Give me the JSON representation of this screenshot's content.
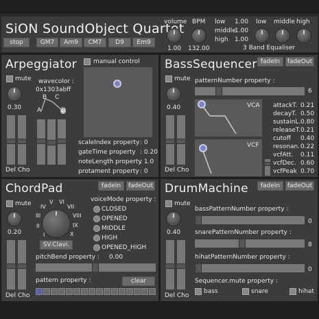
{
  "app": {
    "title": "SiON SoundObject Quartet"
  },
  "header": {
    "stop_label": "stop",
    "chords": [
      "GM7",
      "Am9",
      "CM7",
      "D9",
      "Em9"
    ],
    "volume": {
      "label": "volume",
      "value": "1.00"
    },
    "bpm": {
      "label": "BPM",
      "value": "132.00"
    },
    "eq_levels": [
      {
        "name": "low",
        "value": "1.00"
      },
      {
        "name": "middle",
        "value": "1.00"
      },
      {
        "name": "high",
        "value": "1.00"
      }
    ],
    "eq_knobs": [
      "low",
      "middle",
      "high"
    ],
    "eq_title": "3 Band Equaliser"
  },
  "arpeggiator": {
    "title": "Arpeggiator",
    "mute_label": "mute",
    "level": "0.30",
    "wavecolor_label": "wavecolor :",
    "wavecolor_value": "0x1303abff",
    "adsr_labels": {
      "a": "A",
      "b": "B",
      "c": "C",
      "d": "D"
    },
    "manual_label": "manual control",
    "props": [
      {
        "name": "scaleIndex property",
        "value": ": 0"
      },
      {
        "name": "gateTime property",
        "value": ": 0.20"
      },
      {
        "name": "noteLength property",
        "value": ": 1.0"
      },
      {
        "name": "protament property",
        "value": ": 0"
      }
    ],
    "del_cho": "Del Cho"
  },
  "bass": {
    "title": "BassSequencer",
    "fadein": "fadeIn",
    "fadeout": "fadeOut",
    "mute_label": "mute",
    "level": "0.40",
    "pattern_label": "patternNumber property :",
    "pattern_value": "6",
    "vca_label": "VCA",
    "vcf_label": "VCF",
    "params": [
      {
        "name": "attackT.",
        "value": "0.21"
      },
      {
        "name": "decayT.",
        "value": "0.50"
      },
      {
        "name": "sustainL.",
        "value": "0.80"
      },
      {
        "name": "releaseT.",
        "value": "0.21"
      },
      {
        "name": "cutoff",
        "value": "0.40"
      },
      {
        "name": "resonan.",
        "value": "0.22"
      },
      {
        "name": "vcfAtt.",
        "value": "0.11"
      },
      {
        "name": "vcfDec.",
        "value": "0.60"
      },
      {
        "name": "vcfPeak",
        "value": "0.70"
      }
    ],
    "del_cho": "Del Cho"
  },
  "chordpad": {
    "title": "ChordPad",
    "fadein": "fadeIn",
    "fadeout": "fadeOut",
    "mute_label": "mute",
    "level": "0.20",
    "roman": [
      "I",
      "II",
      "III",
      "IV",
      "V",
      "VI",
      "VII",
      "VIII",
      "IX",
      "X"
    ],
    "voice_button": "SV.Clavi.",
    "voicemode_label": "voiceMode property :",
    "voicemodes": [
      "CLOSED",
      "OPENED",
      "MIDDLE",
      "HIGH",
      "OPENED_HIGH"
    ],
    "pitchbend_label": "pitchBend property :",
    "pitchbend_value": "0.00",
    "pattern_label": "pattern property :",
    "clear_label": "clear",
    "pattern_steps": [
      1,
      0,
      0,
      0,
      0,
      0,
      0,
      0,
      0,
      0,
      0,
      0,
      0,
      0,
      0,
      0
    ],
    "del_cho": "Del Cho"
  },
  "drum": {
    "title": "DrumMachine",
    "fadein": "fadeIn",
    "fadeout": "fadeOut",
    "mute_label": "mute",
    "level": "0.40",
    "bass_pattern_label": "bassPatternNumber property :",
    "bass_pattern_value": "0",
    "snare_pattern_label": "snarePatternNumber property :",
    "snare_pattern_value": "8",
    "hihat_pattern_label": "hihatPatternNumber property :",
    "hihat_pattern_value": "0",
    "seq_mute_label": "Sequencer.mute property :",
    "mute_items": [
      "bass",
      "snare",
      "hihat"
    ],
    "del_cho": "Del Cho"
  },
  "colors": {
    "background": "#1e1e1e",
    "panel": "#3c3c3c",
    "accent": "#7a84c8",
    "step_active": "#5a62a8"
  }
}
